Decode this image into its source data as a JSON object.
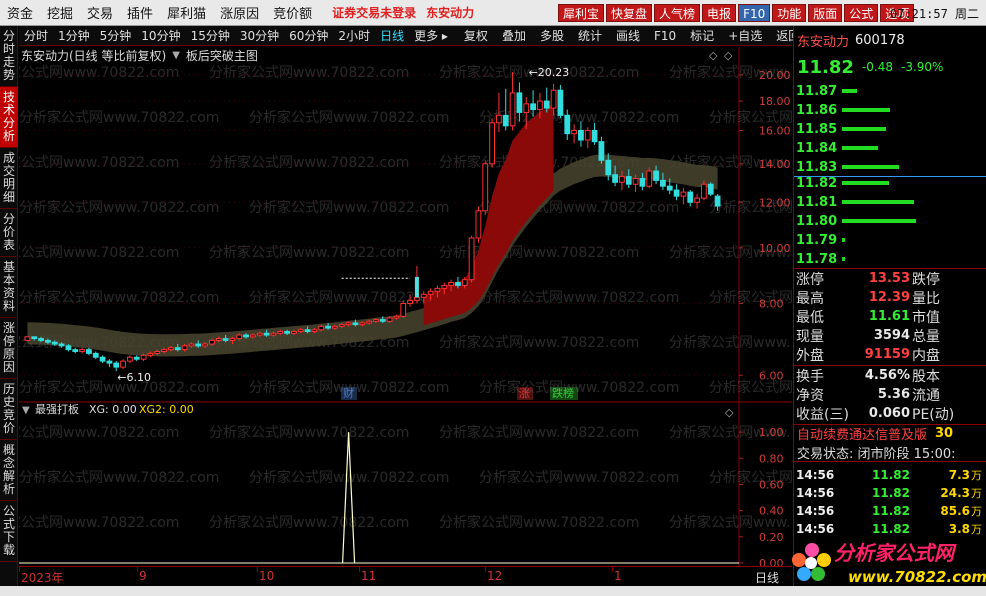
{
  "menu": [
    "资金",
    "挖掘",
    "交易",
    "插件",
    "犀利猫",
    "涨原因",
    "竞价额"
  ],
  "alerts": [
    {
      "text": "证券交易未登录",
      "color": "#e02020"
    },
    {
      "text": "东安动力",
      "color": "#e02020"
    }
  ],
  "top_buttons": [
    "犀利宝",
    "快复盘",
    "人气榜",
    "电报",
    "F10",
    "功能",
    "版面",
    "公式",
    "选项"
  ],
  "clock": "07:21:57 周二",
  "left_tabs": [
    {
      "label": "分时走势",
      "active": false
    },
    {
      "label": "技术分析",
      "active": true
    },
    {
      "label": "成交明细",
      "active": false
    },
    {
      "label": "分价表",
      "active": false
    },
    {
      "label": "基本资料",
      "active": false
    },
    {
      "label": "涨停原因",
      "active": false
    },
    {
      "label": "历史竞价",
      "active": false
    },
    {
      "label": "概念解析",
      "active": false
    },
    {
      "label": "公式下载",
      "active": false
    }
  ],
  "periods": [
    "分时",
    "1分钟",
    "5分钟",
    "10分钟",
    "15分钟",
    "30分钟",
    "60分钟",
    "2小时",
    "日线",
    "更多"
  ],
  "selected_period": "日线",
  "tools": [
    "复权",
    "叠加",
    "多股",
    "统计",
    "画线",
    "F10",
    "标记",
    "+自选",
    "返回"
  ],
  "chart_header": {
    "title": "东安动力(日线 等比前复权)",
    "indicator": "板后突破主图"
  },
  "sub_header": {
    "name": "最强打板",
    "xg": "XG: 0.00",
    "xg2": "XG2: 0.00"
  },
  "stock": {
    "name": "东安动力",
    "code": "600178",
    "price": "11.82",
    "change": "-0.48",
    "pct": "-3.90%"
  },
  "sell_levels": [
    {
      "price": "11.87",
      "vol": 22
    },
    {
      "price": "11.86",
      "vol": 72
    },
    {
      "price": "11.85",
      "vol": 66
    },
    {
      "price": "11.84",
      "vol": 54
    },
    {
      "price": "11.83",
      "vol": 85
    }
  ],
  "buy_levels": [
    {
      "price": "11.82",
      "vol": 70
    },
    {
      "price": "11.81",
      "vol": 108
    },
    {
      "price": "11.80",
      "vol": 110
    },
    {
      "price": "11.79",
      "vol": 4
    },
    {
      "price": "11.78",
      "vol": 4
    }
  ],
  "stats": [
    {
      "l1": "涨停",
      "v": "13.53",
      "c": "#ff4040",
      "l2": "跌停"
    },
    {
      "l1": "最高",
      "v": "12.39",
      "c": "#ff4040",
      "l2": "量比"
    },
    {
      "l1": "最低",
      "v": "11.61",
      "c": "#33ee33",
      "l2": "市值"
    },
    {
      "l1": "现量",
      "v": "3594",
      "c": "#e8e8e8",
      "l2": "总量"
    },
    {
      "l1": "外盘",
      "v": "91159",
      "c": "#ff4040",
      "l2": "内盘"
    }
  ],
  "stats2": [
    {
      "l1": "换手",
      "v": "4.56%",
      "c": "#e8e8e8",
      "l2": "股本"
    },
    {
      "l1": "净资",
      "v": "5.36",
      "c": "#e8e8e8",
      "l2": "流通"
    },
    {
      "l1": "收益(三)",
      "v": "0.060",
      "c": "#e8e8e8",
      "l2": "PE(动)"
    }
  ],
  "promo": "自动续费通达信普及版",
  "promo_tail": "30",
  "trade_status": "交易状态: 闭市阶段 15:00:",
  "ticks": [
    {
      "t": "14:56",
      "p": "11.82",
      "v": "7.3",
      "u": "万"
    },
    {
      "t": "14:56",
      "p": "11.82",
      "v": "24.3",
      "u": "万"
    },
    {
      "t": "14:56",
      "p": "11.82",
      "v": "85.6",
      "u": "万"
    },
    {
      "t": "14:56",
      "p": "11.82",
      "v": "3.8",
      "u": "万"
    }
  ],
  "time_axis": [
    "2023年",
    "9",
    "10",
    "11",
    "12",
    "1"
  ],
  "time_axis_tail": "日线",
  "watermark": "分析家公式网www.70822.com",
  "logo": {
    "title": "分析家公式网",
    "url": "www.70822.com"
  },
  "event_marks": [
    {
      "text": "财",
      "color": "#4a7acc"
    },
    {
      "text": "涨",
      "color": "#dd3333"
    },
    {
      "text": "跌榜",
      "color": "#33cc33"
    }
  ],
  "annotations": {
    "high": "20.23",
    "low": "6.10"
  },
  "chart_data": {
    "type": "candlestick",
    "price_axis": {
      "ticks": [
        20.0,
        18.0,
        16.0,
        14.0,
        12.0,
        10.0,
        8.0,
        6.0
      ],
      "ylim": [
        5.5,
        20.8
      ],
      "log": true
    },
    "indicator_axis": {
      "ticks": [
        1.0,
        0.8,
        0.6,
        0.4,
        0.2,
        0.0
      ],
      "ylim": [
        0,
        1.1
      ]
    },
    "candles": [
      [
        6.9,
        7.0,
        6.9,
        7.0
      ],
      [
        7.0,
        7.0,
        6.9,
        6.95
      ],
      [
        6.95,
        7.0,
        6.85,
        6.9
      ],
      [
        6.9,
        6.95,
        6.8,
        6.85
      ],
      [
        6.85,
        6.9,
        6.75,
        6.8
      ],
      [
        6.8,
        6.85,
        6.7,
        6.75
      ],
      [
        6.75,
        6.8,
        6.6,
        6.65
      ],
      [
        6.65,
        6.7,
        6.55,
        6.6
      ],
      [
        6.6,
        6.7,
        6.55,
        6.65
      ],
      [
        6.65,
        6.7,
        6.5,
        6.55
      ],
      [
        6.55,
        6.6,
        6.4,
        6.45
      ],
      [
        6.45,
        6.5,
        6.3,
        6.35
      ],
      [
        6.35,
        6.4,
        6.2,
        6.3
      ],
      [
        6.3,
        6.35,
        6.1,
        6.2
      ],
      [
        6.2,
        6.4,
        6.15,
        6.35
      ],
      [
        6.35,
        6.5,
        6.3,
        6.45
      ],
      [
        6.45,
        6.5,
        6.35,
        6.4
      ],
      [
        6.4,
        6.55,
        6.35,
        6.5
      ],
      [
        6.5,
        6.6,
        6.45,
        6.55
      ],
      [
        6.55,
        6.65,
        6.5,
        6.6
      ],
      [
        6.6,
        6.7,
        6.55,
        6.65
      ],
      [
        6.65,
        6.75,
        6.6,
        6.7
      ],
      [
        6.7,
        6.8,
        6.6,
        6.65
      ],
      [
        6.65,
        6.8,
        6.6,
        6.75
      ],
      [
        6.75,
        6.85,
        6.7,
        6.8
      ],
      [
        6.8,
        6.9,
        6.7,
        6.75
      ],
      [
        6.75,
        6.85,
        6.7,
        6.8
      ],
      [
        6.8,
        6.95,
        6.75,
        6.9
      ],
      [
        6.9,
        7.0,
        6.85,
        6.95
      ],
      [
        6.95,
        7.05,
        6.85,
        6.9
      ],
      [
        6.9,
        7.0,
        6.8,
        6.95
      ],
      [
        6.95,
        7.1,
        6.9,
        7.05
      ],
      [
        7.05,
        7.1,
        6.95,
        7.0
      ],
      [
        7.0,
        7.1,
        6.95,
        7.05
      ],
      [
        7.05,
        7.15,
        7.0,
        7.1
      ],
      [
        7.1,
        7.2,
        7.0,
        7.05
      ],
      [
        7.05,
        7.15,
        7.0,
        7.1
      ],
      [
        7.1,
        7.2,
        7.05,
        7.15
      ],
      [
        7.15,
        7.2,
        7.05,
        7.1
      ],
      [
        7.1,
        7.2,
        7.05,
        7.15
      ],
      [
        7.15,
        7.25,
        7.1,
        7.2
      ],
      [
        7.2,
        7.3,
        7.1,
        7.15
      ],
      [
        7.15,
        7.25,
        7.1,
        7.2
      ],
      [
        7.2,
        7.35,
        7.15,
        7.3
      ],
      [
        7.3,
        7.4,
        7.2,
        7.25
      ],
      [
        7.25,
        7.35,
        7.2,
        7.3
      ],
      [
        7.3,
        7.4,
        7.25,
        7.35
      ],
      [
        7.35,
        7.45,
        7.3,
        7.4
      ],
      [
        7.4,
        7.5,
        7.3,
        7.35
      ],
      [
        7.35,
        7.45,
        7.3,
        7.4
      ],
      [
        7.4,
        7.5,
        7.35,
        7.45
      ],
      [
        7.45,
        7.55,
        7.4,
        7.5
      ],
      [
        7.5,
        7.6,
        7.4,
        7.45
      ],
      [
        7.45,
        7.6,
        7.4,
        7.55
      ],
      [
        7.55,
        7.65,
        7.5,
        7.6
      ],
      [
        7.6,
        8.1,
        7.55,
        8.0
      ],
      [
        8.0,
        8.3,
        7.9,
        8.1
      ],
      [
        8.1,
        9.3,
        8.0,
        8.2
      ],
      [
        8.2,
        8.4,
        8.0,
        8.3
      ],
      [
        8.3,
        8.5,
        8.1,
        8.4
      ],
      [
        8.4,
        8.6,
        8.2,
        8.5
      ],
      [
        8.5,
        8.7,
        8.3,
        8.6
      ],
      [
        8.6,
        8.8,
        8.4,
        8.7
      ],
      [
        8.7,
        8.9,
        8.5,
        8.6
      ],
      [
        8.6,
        8.9,
        8.5,
        8.8
      ],
      [
        8.8,
        10.5,
        8.7,
        10.4
      ],
      [
        10.4,
        11.8,
        10.2,
        11.6
      ],
      [
        11.6,
        14.2,
        11.4,
        14.0
      ],
      [
        14.0,
        16.8,
        13.8,
        16.5
      ],
      [
        16.5,
        18.6,
        15.9,
        17.0
      ],
      [
        17.0,
        18.9,
        16.0,
        16.3
      ],
      [
        16.3,
        20.23,
        16.0,
        18.6
      ],
      [
        18.6,
        19.4,
        16.6,
        17.2
      ],
      [
        17.2,
        18.3,
        16.1,
        17.8
      ],
      [
        17.8,
        18.8,
        16.9,
        17.4
      ],
      [
        17.4,
        18.6,
        16.8,
        18.0
      ],
      [
        18.0,
        19.0,
        17.2,
        17.5
      ],
      [
        17.5,
        19.3,
        17.0,
        18.8
      ],
      [
        18.8,
        19.2,
        16.8,
        17.0
      ],
      [
        17.0,
        17.4,
        15.4,
        15.8
      ],
      [
        15.8,
        16.4,
        15.2,
        16.0
      ],
      [
        16.0,
        16.6,
        15.0,
        15.4
      ],
      [
        15.4,
        16.2,
        14.9,
        16.0
      ],
      [
        16.0,
        16.5,
        15.1,
        15.3
      ],
      [
        15.3,
        15.6,
        14.0,
        14.2
      ],
      [
        14.2,
        14.6,
        13.1,
        13.4
      ],
      [
        13.4,
        13.9,
        12.8,
        13.0
      ],
      [
        13.0,
        13.6,
        12.6,
        13.3
      ],
      [
        13.3,
        13.7,
        12.7,
        12.9
      ],
      [
        12.9,
        13.4,
        12.5,
        13.2
      ],
      [
        13.2,
        13.5,
        12.6,
        12.8
      ],
      [
        12.8,
        13.8,
        12.7,
        13.6
      ],
      [
        13.6,
        13.9,
        12.9,
        13.1
      ],
      [
        13.1,
        13.5,
        12.6,
        12.8
      ],
      [
        12.8,
        13.2,
        12.4,
        12.6
      ],
      [
        12.6,
        12.9,
        12.1,
        12.3
      ],
      [
        12.3,
        12.7,
        11.9,
        12.5
      ],
      [
        12.5,
        12.6,
        11.8,
        12.0
      ],
      [
        12.0,
        12.4,
        11.7,
        12.2
      ],
      [
        12.2,
        13.1,
        12.1,
        12.9
      ],
      [
        12.9,
        13.0,
        12.3,
        12.4
      ],
      [
        12.3,
        12.4,
        11.6,
        11.82
      ]
    ],
    "signal_index": 47
  }
}
